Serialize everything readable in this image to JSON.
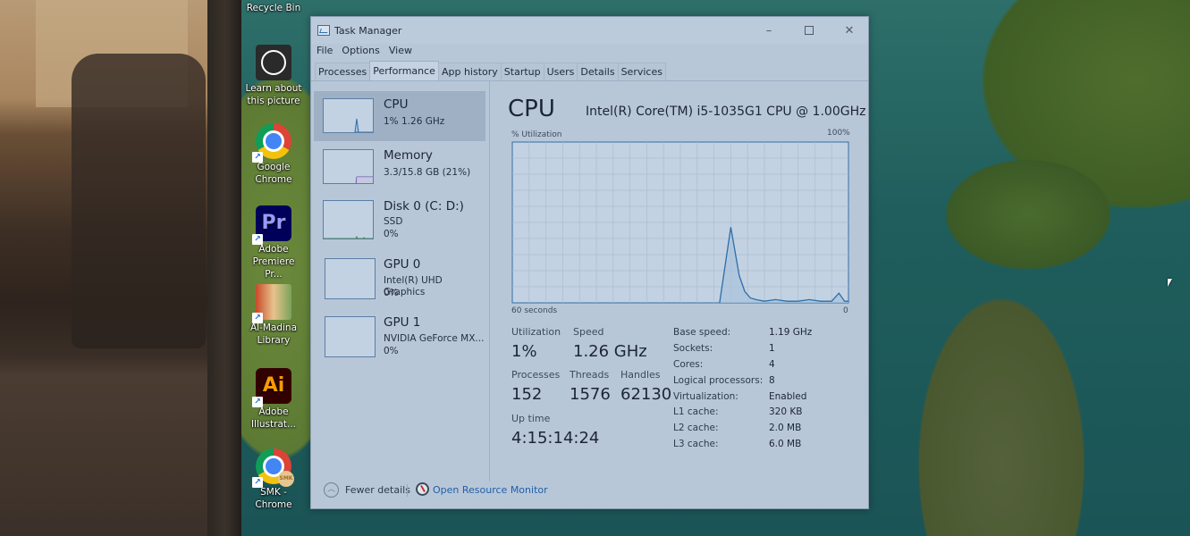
{
  "desktop": {
    "icons": [
      {
        "label": "Recycle Bin",
        "icon": "recycle-bin-icon"
      },
      {
        "label": "Learn about this picture",
        "icon": "learn-picture-icon"
      },
      {
        "label": "Google Chrome",
        "icon": "chrome-icon"
      },
      {
        "label": "Adobe Premiere Pr...",
        "icon": "premiere-icon",
        "glyph": "Pr"
      },
      {
        "label": "Al-Madina Library",
        "icon": "library-icon"
      },
      {
        "label": "Adobe Illustrat...",
        "icon": "illustrator-icon",
        "glyph": "Ai"
      },
      {
        "label": "SMK - Chrome",
        "icon": "chrome-profile-icon",
        "badge": "SMK"
      }
    ]
  },
  "window": {
    "title": "Task Manager",
    "controls": {
      "minimize": "–",
      "maximize": "",
      "close": "✕"
    },
    "menu": [
      "File",
      "Options",
      "View"
    ],
    "tabs": [
      {
        "label": "Processes",
        "active": false
      },
      {
        "label": "Performance",
        "active": true
      },
      {
        "label": "App history",
        "active": false
      },
      {
        "label": "Startup",
        "active": false
      },
      {
        "label": "Users",
        "active": false
      },
      {
        "label": "Details",
        "active": false
      },
      {
        "label": "Services",
        "active": false
      }
    ]
  },
  "sidebar": {
    "items": [
      {
        "name": "CPU",
        "lines": [
          "1%  1.26 GHz"
        ],
        "selected": true,
        "graph": "cpu"
      },
      {
        "name": "Memory",
        "lines": [
          "3.3/15.8 GB (21%)"
        ],
        "selected": false,
        "graph": "memory",
        "percent": 21
      },
      {
        "name": "Disk 0 (C: D:)",
        "lines": [
          "SSD",
          "0%"
        ],
        "selected": false,
        "graph": "disk"
      },
      {
        "name": "GPU 0",
        "lines": [
          "Intel(R) UHD Graphics",
          "0%"
        ],
        "selected": false,
        "graph": "none"
      },
      {
        "name": "GPU 1",
        "lines": [
          "NVIDIA GeForce MX...",
          "0%"
        ],
        "selected": false,
        "graph": "none"
      }
    ]
  },
  "main": {
    "title": "CPU",
    "model": "Intel(R) Core(TM) i5-1035G1 CPU @ 1.00GHz",
    "graph_label": "% Utilization",
    "graph_max": "100%",
    "graph_time_left": "60 seconds",
    "graph_time_right": "0",
    "stats": {
      "utilization_label": "Utilization",
      "utilization": "1%",
      "speed_label": "Speed",
      "speed": "1.26 GHz",
      "processes_label": "Processes",
      "processes": "152",
      "threads_label": "Threads",
      "threads": "1576",
      "handles_label": "Handles",
      "handles": "62130",
      "uptime_label": "Up time",
      "uptime": "4:15:14:24"
    },
    "specs": [
      {
        "label": "Base speed:",
        "value": "1.19 GHz"
      },
      {
        "label": "Sockets:",
        "value": "1"
      },
      {
        "label": "Cores:",
        "value": "4"
      },
      {
        "label": "Logical processors:",
        "value": "8"
      },
      {
        "label": "Virtualization:",
        "value": "Enabled"
      },
      {
        "label": "L1 cache:",
        "value": "320 KB"
      },
      {
        "label": "L2 cache:",
        "value": "2.0 MB"
      },
      {
        "label": "L3 cache:",
        "value": "6.0 MB"
      }
    ]
  },
  "footer": {
    "fewer_details": "Fewer details",
    "open_resource_monitor": "Open Resource Monitor"
  },
  "colors": {
    "graph_line": "#2f6ea8",
    "graph_fill": "#a9c2dc",
    "link": "#1f5fa6"
  },
  "chart_data": {
    "type": "area",
    "title": "CPU % Utilization",
    "xlabel": "seconds ago",
    "ylabel": "% Utilization",
    "xlim": [
      60,
      0
    ],
    "ylim": [
      0,
      100
    ],
    "grid": true,
    "x": [
      23,
      21,
      19.5,
      18.5,
      17.5,
      16.5,
      15,
      13,
      11,
      9,
      7,
      5,
      3,
      1.7,
      0.7,
      0
    ],
    "series": [
      {
        "name": "CPU",
        "values": [
          0,
          47,
          17,
          7,
          3,
          2,
          1,
          2,
          1,
          1,
          2,
          1,
          1,
          6,
          1,
          1
        ]
      }
    ]
  }
}
